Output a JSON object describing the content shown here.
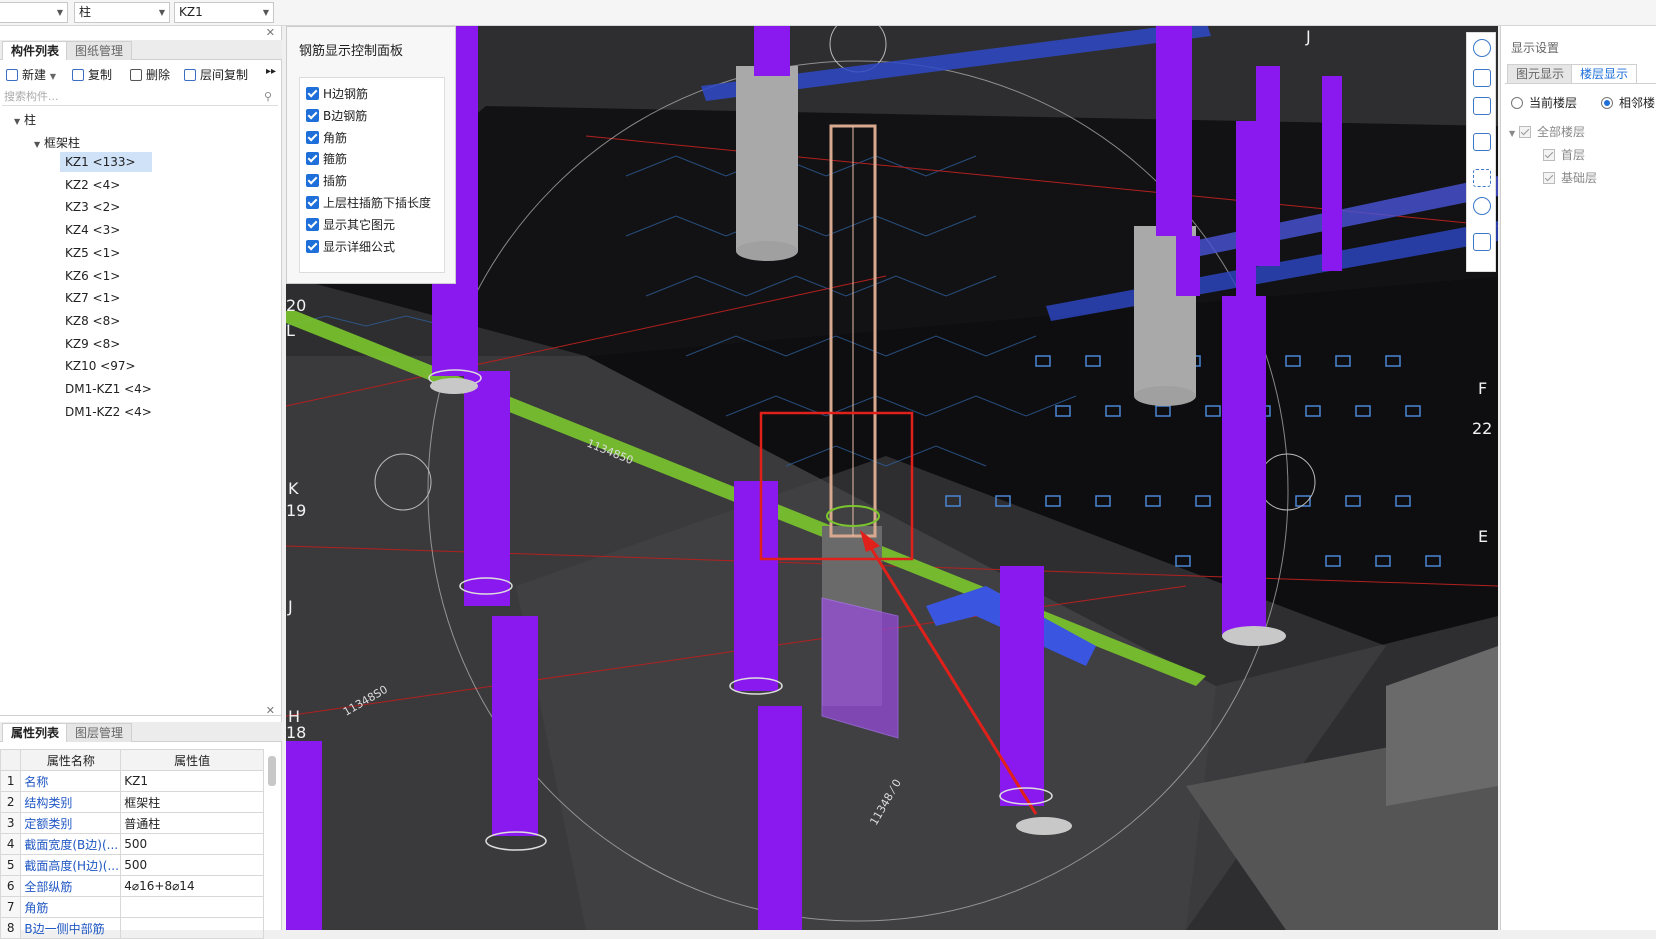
{
  "topbar": {
    "combo1": "",
    "combo2": "柱",
    "combo3": "KZ1"
  },
  "component_panel": {
    "tabs": [
      "构件列表",
      "图纸管理"
    ],
    "toolbar": {
      "new": "新建",
      "copy": "复制",
      "delete": "删除",
      "floor_copy": "层间复制"
    },
    "search_placeholder": "搜索构件...",
    "tree_root": "柱",
    "tree_group": "框架柱",
    "items": [
      "KZ1 <133>",
      "KZ2 <4>",
      "KZ3 <2>",
      "KZ4 <3>",
      "KZ5 <1>",
      "KZ6 <1>",
      "KZ7 <1>",
      "KZ8 <8>",
      "KZ9 <8>",
      "KZ10 <97>",
      "DM1-KZ1 <4>",
      "DM1-KZ2 <4>"
    ]
  },
  "property_panel": {
    "tabs": [
      "属性列表",
      "图层管理"
    ],
    "headers": [
      "属性名称",
      "属性值"
    ],
    "rows": [
      {
        "num": "1",
        "name": "名称",
        "value": "KZ1"
      },
      {
        "num": "2",
        "name": "结构类别",
        "value": "框架柱"
      },
      {
        "num": "3",
        "name": "定额类别",
        "value": "普通柱"
      },
      {
        "num": "4",
        "name": "截面宽度(B边)(...",
        "value": "500"
      },
      {
        "num": "5",
        "name": "截面高度(H边)(...",
        "value": "500"
      },
      {
        "num": "6",
        "name": "全部纵筋",
        "value": "4⌀16+8⌀14"
      },
      {
        "num": "7",
        "name": "角筋",
        "value": ""
      },
      {
        "num": "8",
        "name": "B边一侧中部筋",
        "value": ""
      }
    ]
  },
  "rebar_panel": {
    "title": "钢筋显示控制面板",
    "options": [
      "H边钢筋",
      "B边钢筋",
      "角筋",
      "箍筋",
      "插筋",
      "上层柱插筋下插长度",
      "显示其它图元",
      "显示详细公式"
    ]
  },
  "viewport": {
    "labels": {
      "l20": "20",
      "lL": "L",
      "lK": "K",
      "l19": "19",
      "lJ": "J",
      "lH": "H",
      "l18": "18",
      "rF": "F",
      "r22": "22",
      "rE": "E",
      "tJ": "J"
    },
    "beam_texts": [
      "1134850",
      "11348S0",
      "11348 ⁄ 0"
    ]
  },
  "display_settings": {
    "title": "显示设置",
    "tabs": [
      "图元显示",
      "楼层显示"
    ],
    "radio_current": "当前楼层",
    "radio_adjacent": "相邻楼",
    "floors_all": "全部楼层",
    "floors": [
      "首层",
      "基础层"
    ]
  },
  "colors": {
    "column": "#8a19ef",
    "rebar_green": "#7bc62d",
    "highlight": "#e0201a",
    "accent": "#1e6fd9"
  }
}
